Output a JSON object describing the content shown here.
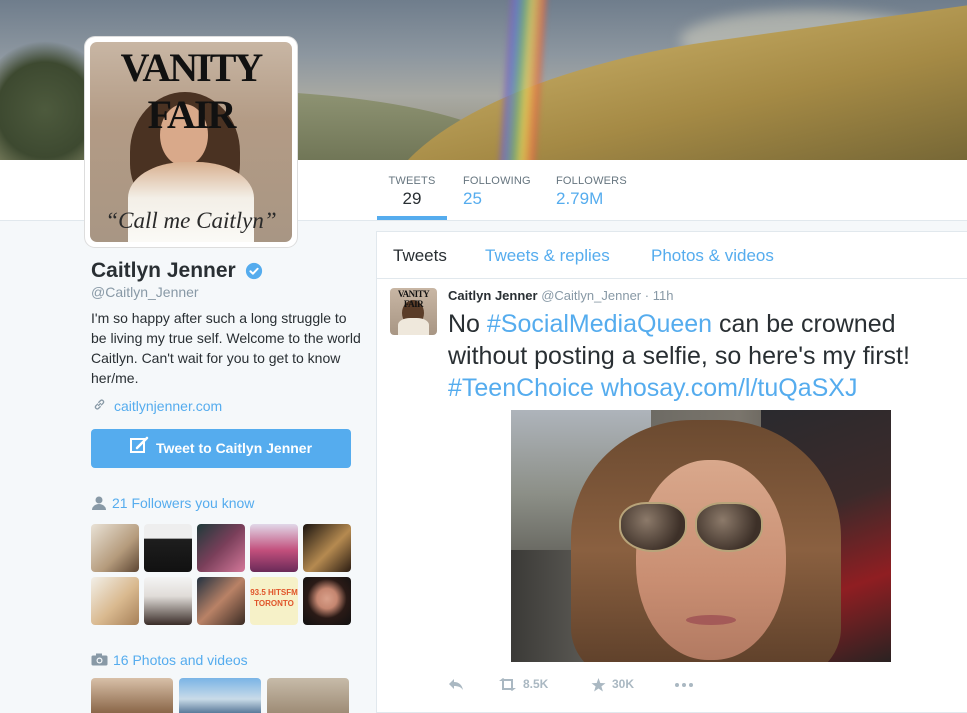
{
  "profile": {
    "name": "Caitlyn Jenner",
    "handle": "@Caitlyn_Jenner",
    "bio": "I'm so happy after such a long struggle to be living my true self. Welcome to the world Caitlyn. Can't wait for you to get to know her/me.",
    "website": "caitlynjenner.com",
    "tweet_to_label": "Tweet to Caitlyn Jenner",
    "avatar": {
      "masthead": "VANITY FAIR",
      "tagline": "“Call me Caitlyn”"
    }
  },
  "stats": [
    {
      "label": "TWEETS",
      "value": "29",
      "active": true
    },
    {
      "label": "FOLLOWING",
      "value": "25",
      "active": false
    },
    {
      "label": "FOLLOWERS",
      "value": "2.79M",
      "active": false
    }
  ],
  "sidebar": {
    "followers_you_know": "21 Followers you know",
    "photos_videos": "16 Photos and videos",
    "follower_thumb_text": "93.5 HITSFM TORONTO"
  },
  "timeline": {
    "tabs": [
      {
        "label": "Tweets",
        "active": true
      },
      {
        "label": "Tweets & replies",
        "active": false
      },
      {
        "label": "Photos & videos",
        "active": false
      }
    ],
    "tweet": {
      "name": "Caitlyn Jenner",
      "handle": "@Caitlyn_Jenner",
      "time": "· 11h",
      "text_1": "No ",
      "hashtag_1": "#SocialMediaQueen",
      "text_2": " can be crowned without posting a selfie, so here's my first! ",
      "hashtag_2": "#TeenChoice",
      "link": "whosay.com/l/tuQaSXJ",
      "retweets": "8.5K",
      "favorites": "30K"
    }
  },
  "colors": {
    "accent": "#55acee",
    "text": "#292f33",
    "muted": "#8899a6",
    "background": "#f5f8fa"
  }
}
